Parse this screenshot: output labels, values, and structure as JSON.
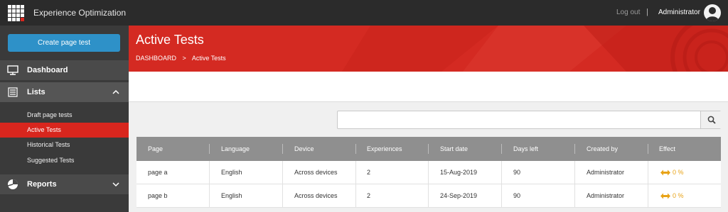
{
  "topbar": {
    "app_title": "Experience Optimization",
    "logout_label": "Log out",
    "separator": "|",
    "user_name": "Administrator"
  },
  "sidebar": {
    "create_button": "Create page test",
    "dashboard_label": "Dashboard",
    "lists_label": "Lists",
    "lists_items": [
      "Draft page tests",
      "Active Tests",
      "Historical Tests",
      "Suggested Tests"
    ],
    "reports_label": "Reports"
  },
  "banner": {
    "title": "Active Tests",
    "breadcrumb_root": "DASHBOARD",
    "breadcrumb_sep": ">",
    "breadcrumb_current": "Active Tests"
  },
  "search": {
    "placeholder": "",
    "value": ""
  },
  "table": {
    "columns": [
      "Page",
      "Language",
      "Device",
      "Experiences",
      "Start date",
      "Days left",
      "Created by",
      "Effect"
    ],
    "rows": [
      [
        "page a",
        "English",
        "Across devices",
        "2",
        "15-Aug-2019",
        "90",
        "Administrator",
        "0 %"
      ],
      [
        "page b",
        "English",
        "Across devices",
        "2",
        "24-Sep-2019",
        "90",
        "Administrator",
        "0 %"
      ]
    ]
  },
  "colors": {
    "accent": "#d42a22",
    "primary_button": "#2e91c8",
    "effect": "#e8a317"
  }
}
